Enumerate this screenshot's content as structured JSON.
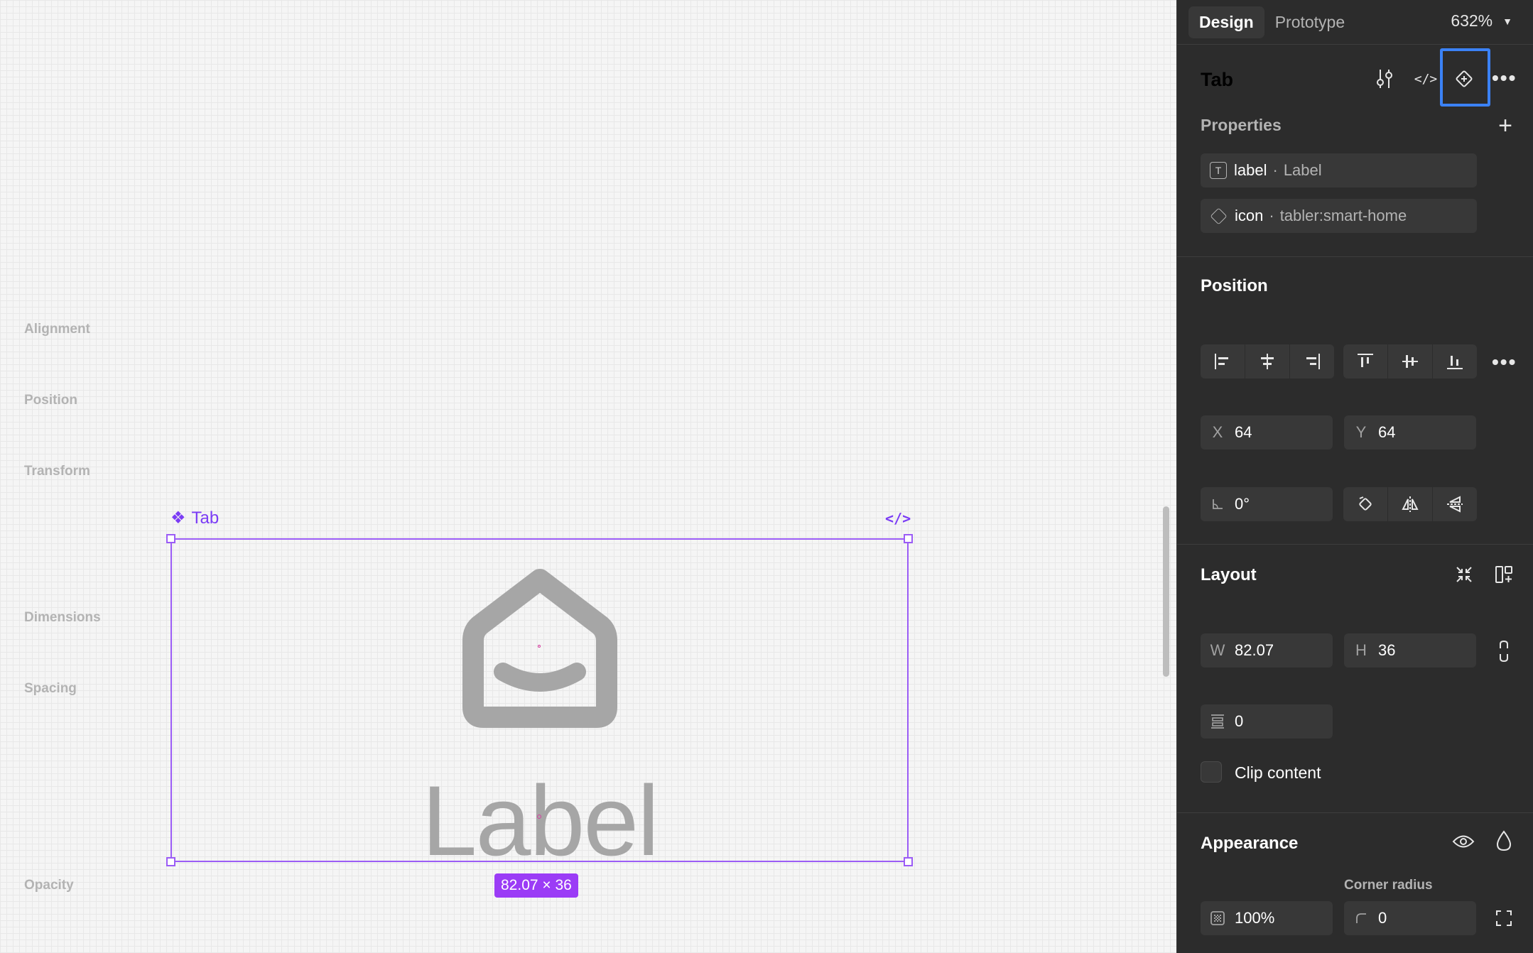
{
  "canvas": {
    "frame_name": "Tab",
    "frame_icon": "component-icon",
    "code_badge": "</>",
    "label_text": "Label",
    "size_badge": "82.07 × 36"
  },
  "panel": {
    "tabs": [
      {
        "label": "Design",
        "active": true
      },
      {
        "label": "Prototype",
        "active": false
      }
    ],
    "zoom": "632%",
    "component": {
      "title": "Tab",
      "header_icons": [
        "settings-sliders-icon",
        "code-icon",
        "component-diamond-icon",
        "more-icon"
      ]
    },
    "properties": {
      "title": "Properties",
      "items": [
        {
          "name": "label",
          "value": "Label",
          "icon": "text-type-icon"
        },
        {
          "name": "icon",
          "value": "tabler:smart-home",
          "icon": "instance-swap-icon"
        }
      ]
    },
    "position": {
      "title": "Position",
      "alignment_label": "Alignment",
      "position_label": "Position",
      "x_label": "X",
      "x": "64",
      "y_label": "Y",
      "y": "64",
      "transform_label": "Transform",
      "rotation": "0°"
    },
    "layout": {
      "title": "Layout",
      "dimensions_label": "Dimensions",
      "w_label": "W",
      "w": "82.07",
      "h_label": "H",
      "h": "36",
      "spacing_label": "Spacing",
      "spacing": "0",
      "clip_content": "Clip content"
    },
    "appearance": {
      "title": "Appearance",
      "opacity_label": "Opacity",
      "opacity": "100%",
      "corner_radius_label": "Corner radius",
      "corner_radius": "0"
    }
  },
  "colors": {
    "selection": "#9b5cf6",
    "highlight": "#3b82f6",
    "panel_bg": "#2c2c2c"
  }
}
